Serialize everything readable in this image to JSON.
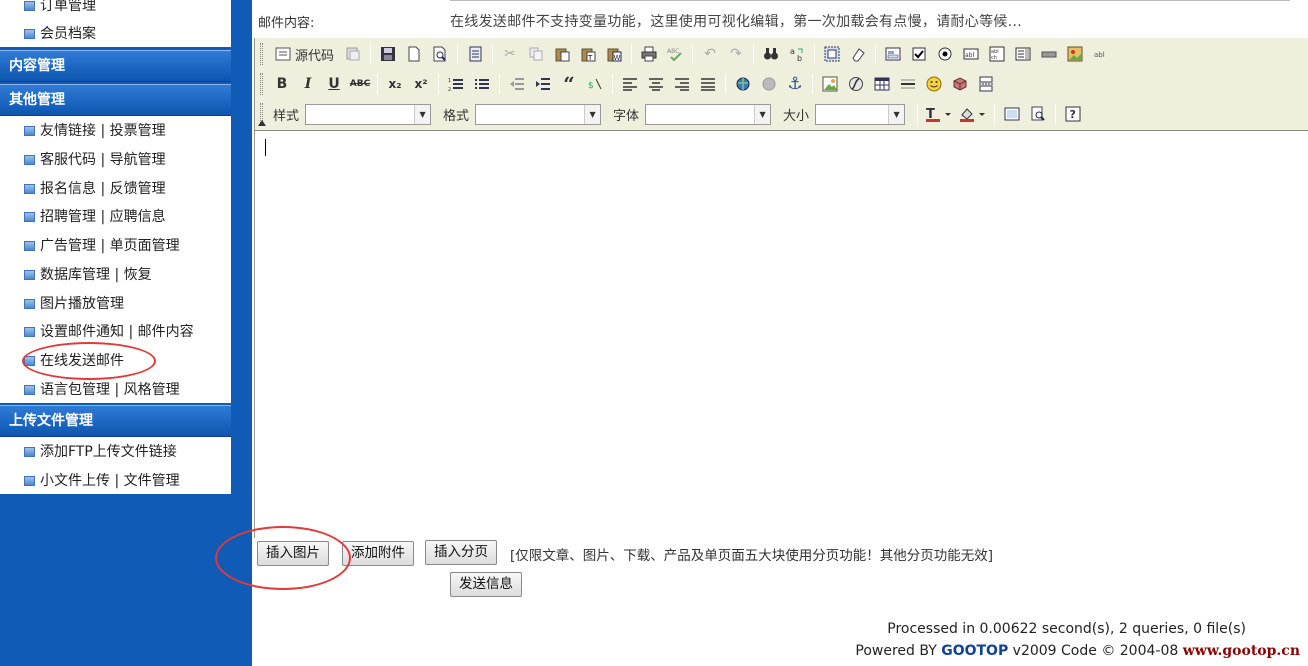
{
  "sidebar": {
    "top_items": [
      "订单管理",
      "会员档案"
    ],
    "sections": [
      {
        "title": "内容管理",
        "items": []
      },
      {
        "title": "其他管理",
        "items": [
          "友情链接 | 投票管理",
          "客服代码 | 导航管理",
          "报名信息 | 反馈管理",
          "招聘管理 | 应聘信息",
          "广告管理 | 单页面管理",
          "数据库管理 | 恢复",
          "图片播放管理",
          "设置邮件通知 | 邮件内容",
          "在线发送邮件",
          "语言包管理 | 风格管理"
        ]
      },
      {
        "title": "上传文件管理",
        "items": [
          "添加FTP上传文件链接",
          "小文件上传 | 文件管理"
        ]
      }
    ]
  },
  "form": {
    "mail_content_label": "邮件内容:",
    "mail_note": "在线发送邮件不支持变量功能，这里使用可视化编辑，第一次加载会有点慢，请耐心等候..."
  },
  "toolbar": {
    "source_label": "源代码",
    "style_label": "样式",
    "format_label": "格式",
    "font_label": "字体",
    "size_label": "大小",
    "bold": "B",
    "italic": "I",
    "underline": "U",
    "strike": "ABC",
    "subscript": "x₂",
    "superscript": "x²"
  },
  "buttons": {
    "insert_image": "插入图片",
    "add_attachment": "添加附件",
    "insert_pagebreak": "插入分页",
    "pagebreak_hint": "[仅限文章、图片、下载、产品及单页面五大块使用分页功能！其他分页功能无效]",
    "send": "发送信息"
  },
  "footer": {
    "processed": "Processed in 0.00622 second(s), 2 queries, 0 file(s)",
    "powered_prefix": "Powered BY ",
    "brand": "GOOTOP",
    "powered_suffix": " v2009 Code © 2004-08 ",
    "site": "www.gootop.cn"
  },
  "colors": {
    "sidebar_bg": "#0f5bb5",
    "toolbar_bg": "#efefde",
    "annotation": "#e03a3a"
  }
}
